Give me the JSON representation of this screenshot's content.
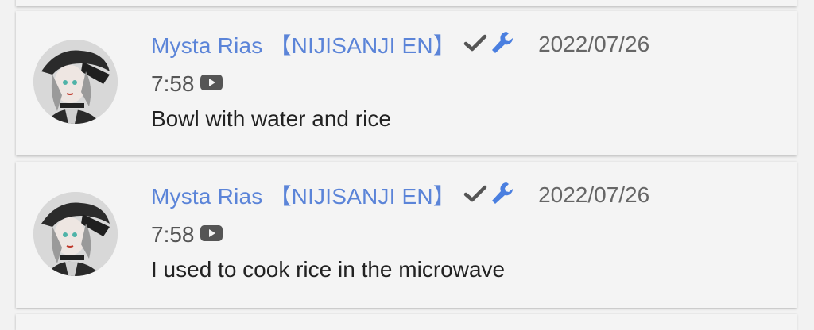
{
  "comments": [
    {
      "author": "Mysta Rias 【NIJISANJI EN】",
      "date": "2022/07/26",
      "timestamp": "7:58",
      "text": "Bowl with water and rice",
      "verified_icon": "check-icon",
      "owner_icon": "wrench-icon",
      "video_icon": "youtube-play-icon"
    },
    {
      "author": "Mysta Rias 【NIJISANJI EN】",
      "date": "2022/07/26",
      "timestamp": "7:58",
      "text": "I used to cook rice in the microwave",
      "verified_icon": "check-icon",
      "owner_icon": "wrench-icon",
      "video_icon": "youtube-play-icon"
    }
  ],
  "colors": {
    "author": "#5b84d8",
    "background": "#f2f2f2",
    "card": "#f4f4f4",
    "date": "#666666",
    "text": "#222222"
  }
}
